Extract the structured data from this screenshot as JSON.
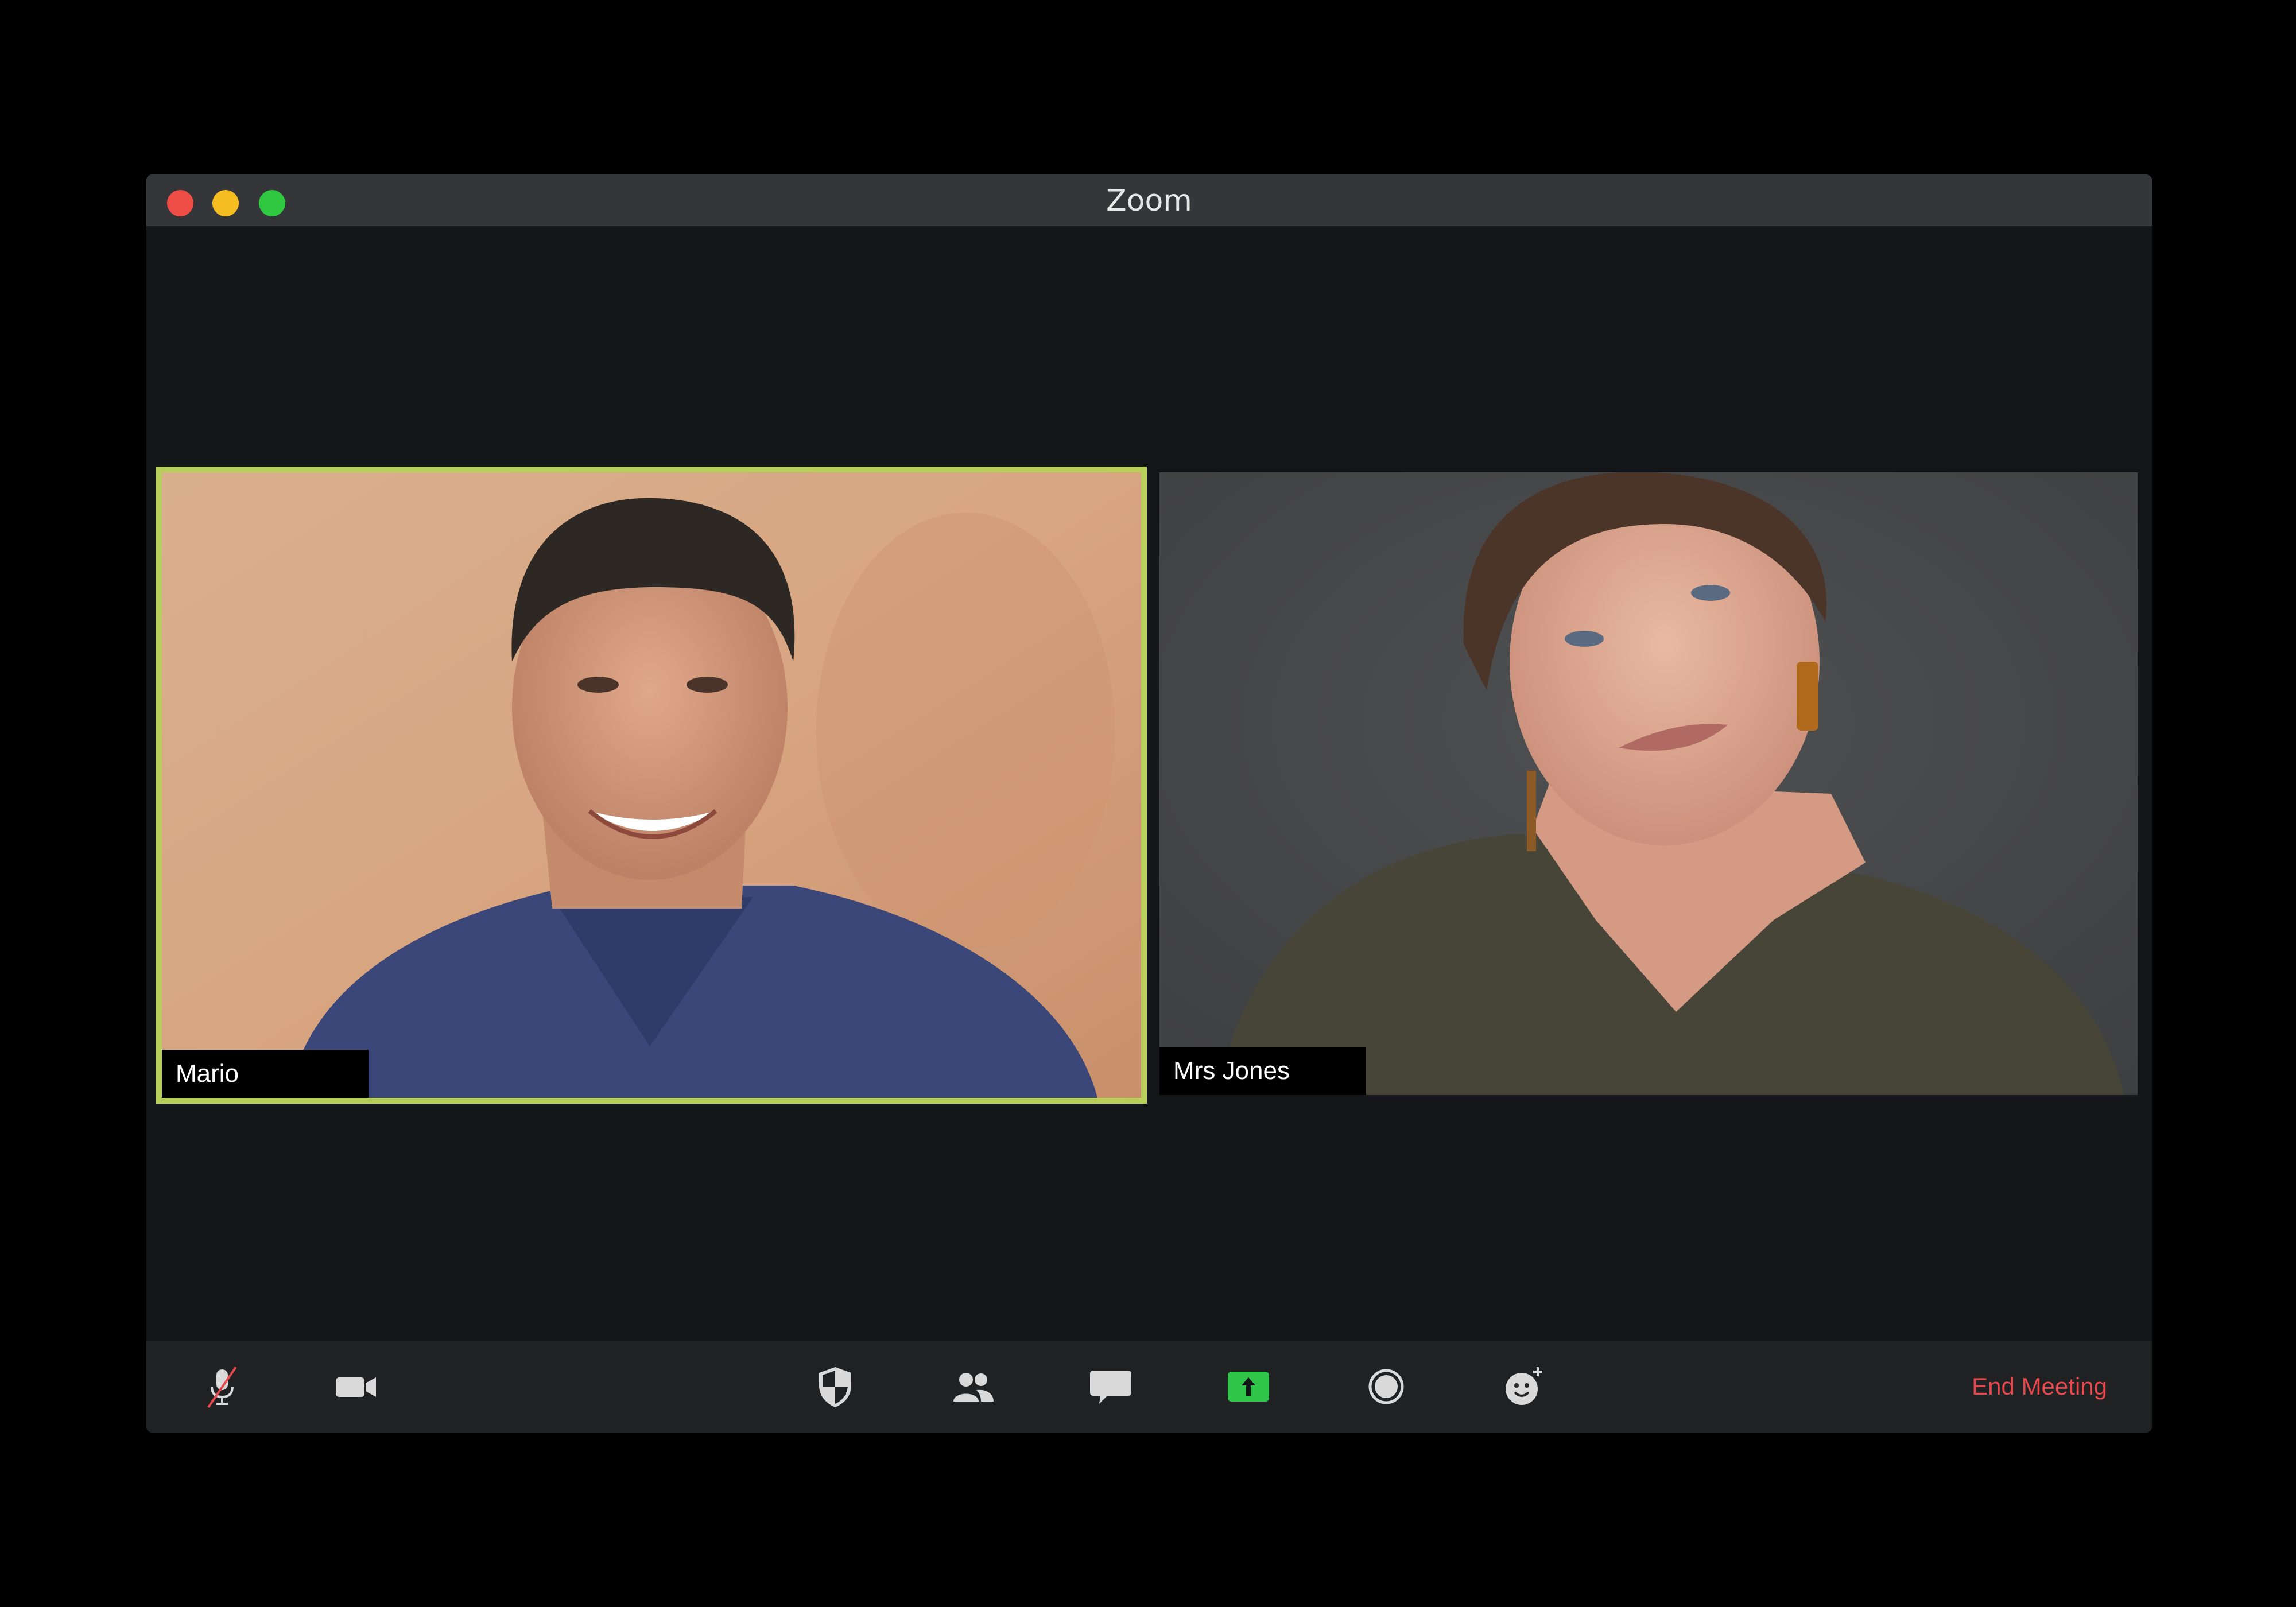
{
  "window": {
    "title": "Zoom",
    "traffic_lights": {
      "close_color": "#ee4e45",
      "minimize_color": "#f5bd20",
      "maximize_color": "#2fc840"
    }
  },
  "participants": [
    {
      "name": "Mario",
      "active_speaker": true,
      "highlight_color": "#b7cf5a"
    },
    {
      "name": "Mrs Jones",
      "active_speaker": false
    }
  ],
  "toolbar": {
    "mute_icon": "microphone-muted-icon",
    "video_icon": "video-camera-icon",
    "security_icon": "shield-icon",
    "participants_icon": "people-icon",
    "chat_icon": "chat-bubble-icon",
    "share_icon": "share-screen-icon",
    "share_color": "#31c44a",
    "record_icon": "record-icon",
    "reactions_icon": "smiley-add-icon",
    "end_meeting_label": "End Meeting",
    "end_meeting_color": "#e5484d"
  }
}
